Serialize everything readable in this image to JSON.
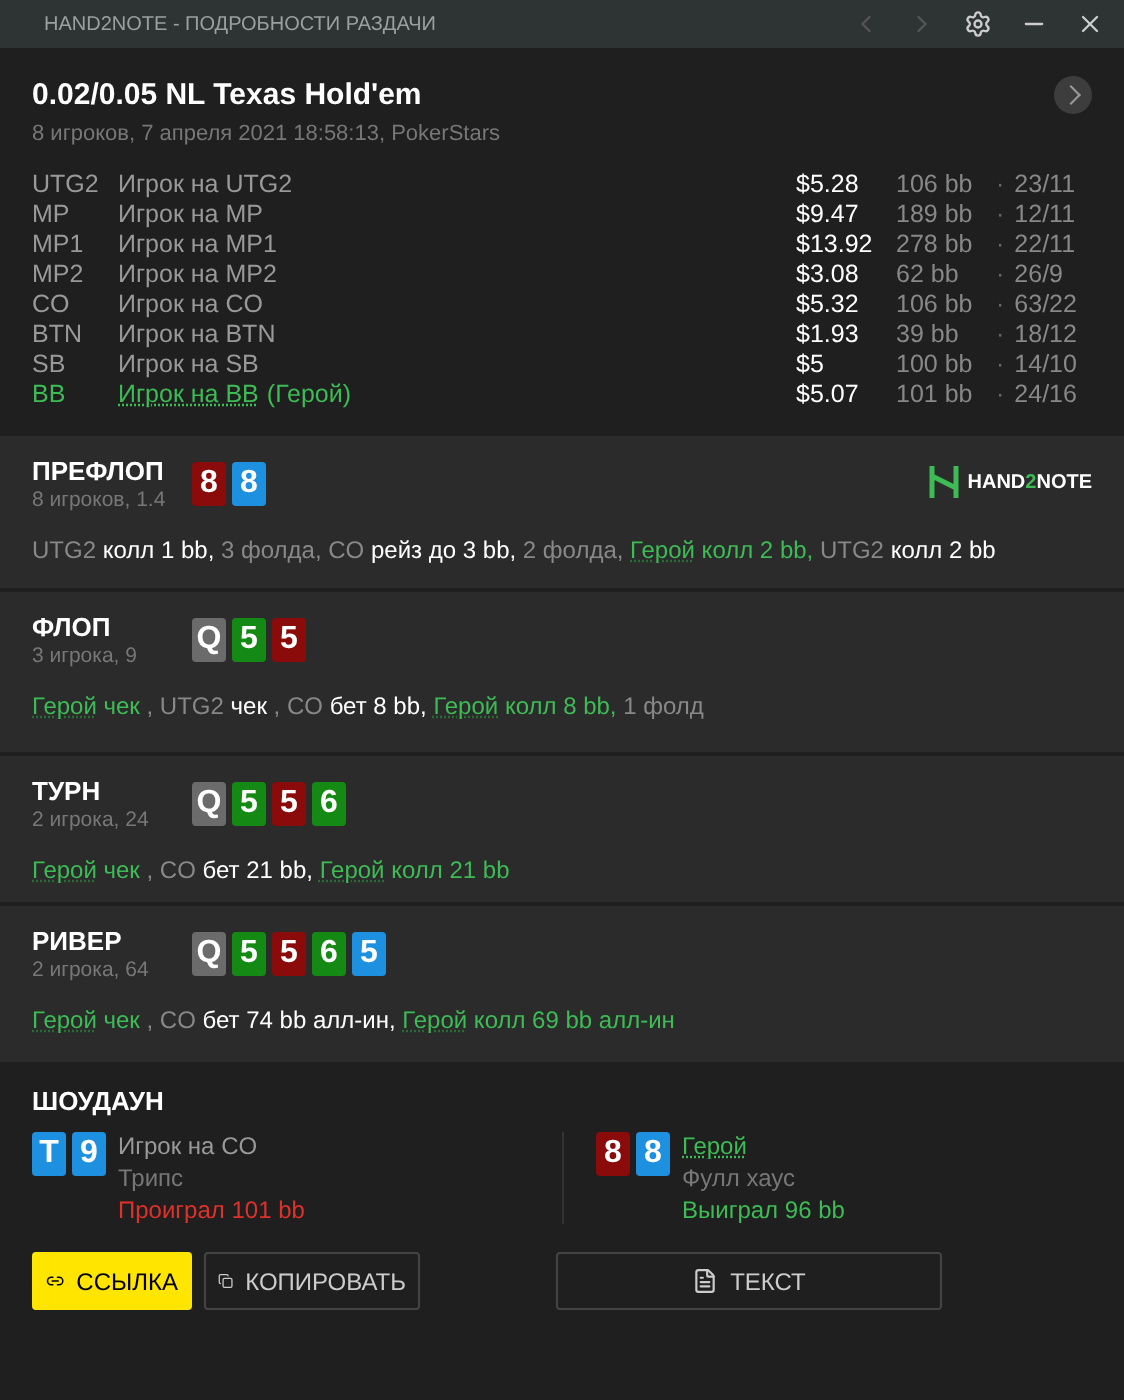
{
  "window": {
    "title": "HAND2NOTE - ПОДРОБНОСТИ РАЗДАЧИ"
  },
  "hand": {
    "title": "0.02/0.05 NL Texas Hold'em",
    "subtitle": "8 игроков, 7 апреля 2021 18:58:13, PokerStars"
  },
  "players": [
    {
      "position": "UTG2",
      "name": "Игрок на UTG2",
      "hero": false,
      "stack": "$5.28",
      "bb": "106 bb",
      "dot": "·",
      "stats": "23/11"
    },
    {
      "position": "MP",
      "name": "Игрок на MP",
      "hero": false,
      "stack": "$9.47",
      "bb": "189 bb",
      "dot": "·",
      "stats": "12/11"
    },
    {
      "position": "MP1",
      "name": "Игрок на MP1",
      "hero": false,
      "stack": "$13.92",
      "bb": "278 bb",
      "dot": "·",
      "stats": "22/11"
    },
    {
      "position": "MP2",
      "name": "Игрок на MP2",
      "hero": false,
      "stack": "$3.08",
      "bb": "62 bb",
      "dot": "·",
      "stats": "26/9"
    },
    {
      "position": "CO",
      "name": "Игрок на CO",
      "hero": false,
      "stack": "$5.32",
      "bb": "106 bb",
      "dot": "·",
      "stats": "63/22"
    },
    {
      "position": "BTN",
      "name": "Игрок на BTN",
      "hero": false,
      "stack": "$1.93",
      "bb": "39 bb",
      "dot": "·",
      "stats": "18/12"
    },
    {
      "position": "SB",
      "name": "Игрок на SB",
      "hero": false,
      "stack": "$5",
      "bb": "100 bb",
      "dot": "·",
      "stats": "14/10"
    },
    {
      "position": "BB",
      "name": "Игрок на BB",
      "hero": true,
      "hero_tag": "(Герой)",
      "stack": "$5.07",
      "bb": "101 bb",
      "dot": "·",
      "stats": "24/16"
    }
  ],
  "streets": [
    {
      "name": "ПРЕФЛОП",
      "info": "8 игроков, 1.4",
      "logo": {
        "text_a": "HAND",
        "text_b": "2",
        "text_c": "NOTE"
      },
      "cards": [
        {
          "rank": "8",
          "color": "#8b0a0a"
        },
        {
          "rank": "8",
          "color": "#1e90e0"
        }
      ],
      "actions": [
        {
          "kind": "player",
          "text": "UTG2 "
        },
        {
          "kind": "bet",
          "text": "колл 1 bb, "
        },
        {
          "kind": "player",
          "text": "3 фолда, CO "
        },
        {
          "kind": "bet",
          "text": "рейз до 3 bb, "
        },
        {
          "kind": "player",
          "text": "2 фолда, "
        },
        {
          "kind": "hero",
          "text": "Герой"
        },
        {
          "kind": "hero_bet",
          "text": " колл 2 bb, "
        },
        {
          "kind": "player",
          "text": "UTG2 "
        },
        {
          "kind": "bet",
          "text": "колл 2 bb"
        }
      ]
    },
    {
      "name": "ФЛОП",
      "info": "3 игрока, 9",
      "cards": [
        {
          "rank": "Q",
          "color": "#6b6b6b"
        },
        {
          "rank": "5",
          "color": "#148a14"
        },
        {
          "rank": "5",
          "color": "#8b0a0a"
        }
      ],
      "actions": [
        {
          "kind": "hero",
          "text": "Герой"
        },
        {
          "kind": "hero_bet",
          "text": " чек "
        },
        {
          "kind": "player",
          "text": ", UTG2 "
        },
        {
          "kind": "bet",
          "text": "чек "
        },
        {
          "kind": "player",
          "text": ", CO "
        },
        {
          "kind": "bet",
          "text": "бет 8 bb, "
        },
        {
          "kind": "hero",
          "text": "Герой"
        },
        {
          "kind": "hero_bet",
          "text": " колл 8 bb, "
        },
        {
          "kind": "player",
          "text": "1 фолд"
        }
      ]
    },
    {
      "name": "ТУРН",
      "info": "2 игрока, 24",
      "cards": [
        {
          "rank": "Q",
          "color": "#6b6b6b"
        },
        {
          "rank": "5",
          "color": "#148a14"
        },
        {
          "rank": "5",
          "color": "#8b0a0a"
        },
        {
          "rank": "6",
          "color": "#148a14"
        }
      ],
      "actions": [
        {
          "kind": "hero",
          "text": "Герой"
        },
        {
          "kind": "hero_bet",
          "text": " чек "
        },
        {
          "kind": "player",
          "text": ", CO "
        },
        {
          "kind": "bet",
          "text": "бет 21 bb, "
        },
        {
          "kind": "hero",
          "text": "Герой"
        },
        {
          "kind": "hero_bet",
          "text": " колл 21 bb"
        }
      ]
    },
    {
      "name": "РИВЕР",
      "info": "2 игрока, 64",
      "cards": [
        {
          "rank": "Q",
          "color": "#6b6b6b"
        },
        {
          "rank": "5",
          "color": "#148a14"
        },
        {
          "rank": "5",
          "color": "#8b0a0a"
        },
        {
          "rank": "6",
          "color": "#148a14"
        },
        {
          "rank": "5",
          "color": "#1e90e0"
        }
      ],
      "actions": [
        {
          "kind": "hero",
          "text": "Герой"
        },
        {
          "kind": "hero_bet",
          "text": " чек "
        },
        {
          "kind": "player",
          "text": ", CO "
        },
        {
          "kind": "bet",
          "text": "бет 74 bb алл-ин, "
        },
        {
          "kind": "hero",
          "text": "Герой"
        },
        {
          "kind": "hero_bet",
          "text": " колл 69 bb алл-ин"
        }
      ]
    }
  ],
  "showdown": {
    "title": "ШОУДАУН",
    "hands": [
      {
        "player": "Игрок на CO",
        "hero": false,
        "combo": "Трипс",
        "result": "Проиграл 101 bb",
        "won": false,
        "cards": [
          {
            "rank": "T",
            "color": "#1e90e0"
          },
          {
            "rank": "9",
            "color": "#1e90e0"
          }
        ]
      },
      {
        "player": "Герой",
        "hero": true,
        "combo": "Фулл хаус",
        "result": "Выиграл 96 bb",
        "won": true,
        "cards": [
          {
            "rank": "8",
            "color": "#8b0a0a"
          },
          {
            "rank": "8",
            "color": "#1e90e0"
          }
        ]
      }
    ]
  },
  "buttons": [
    {
      "kind": "link",
      "label": "ССЫЛКА"
    },
    {
      "kind": "copy",
      "label": "КОПИРОВАТЬ"
    },
    {
      "kind": "text",
      "label": "ТЕКСТ"
    }
  ]
}
